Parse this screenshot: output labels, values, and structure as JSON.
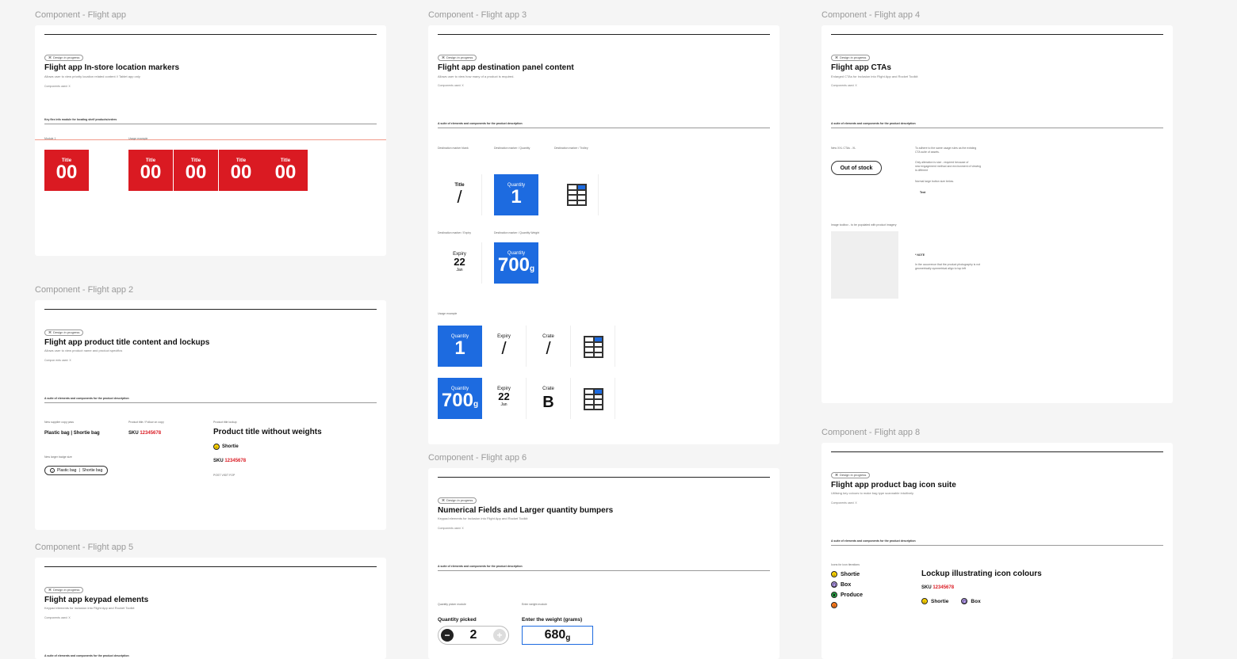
{
  "frames": {
    "f1": {
      "label": "Component - Flight app",
      "pill": "Design in progress",
      "title": "Flight app In-store location markers",
      "subtitle": "Allows user to view priority location related content // Tablet app only",
      "meta": "Components used: X",
      "section": "Key flex info module for locating shelf products/orders",
      "col1_label": "Module 1",
      "col2_label": "Usage example",
      "marker_title": "Title",
      "marker_value": "00"
    },
    "f2": {
      "label": "Component - Flight app 2",
      "pill": "Design in progress",
      "title": "Flight app product title content and lockups",
      "subtitle": "Allows user to view product name and product specifics",
      "meta": "Compon ents used: X",
      "section": "A suite of elements and components for the product description",
      "col1_label": "New supplier copy pass",
      "col2_label": "Product title / Follow on copy",
      "col3_label": "Product title lockup",
      "bag_text": "Plastic bag",
      "bag_text2": "Shortie bag",
      "sep": "|",
      "sku_label": "SKU",
      "sku_value": "12345678",
      "product_title": "Product title without weights",
      "shortie_label": "Shortie",
      "badge_label": "New larger badge size",
      "footer_note": "POST VISIT FOP"
    },
    "f3": {
      "label": "Component - Flight app 3",
      "pill": "Design in progress",
      "title": "Flight app destination panel content",
      "subtitle": "Allows user to view how many of a product is required.",
      "meta": "Components used: X",
      "section": "A suite of elements and components for the product description",
      "lab_a": "Destination marker blank",
      "lab_b": "Destination marker / Quantity",
      "lab_c": "Destination marker / Trolley",
      "lab_d": "Destination marker / Expiry",
      "lab_e": "Destination marker / Quantity Weight",
      "usage": "Usage example",
      "title_word": "Title",
      "slash": "/",
      "quantity": "Quantity",
      "qty_one": "1",
      "expiry": "Expiry",
      "day": "22",
      "month": "Jan",
      "weight": "700",
      "weight_unit": "g",
      "crate": "Crate",
      "crate_val": "B"
    },
    "f4": {
      "label": "Component - Flight app 4",
      "pill": "Design in progress",
      "title": "Flight app CTAs",
      "subtitle": "Enlarged CTAs for inclusion into Flight App and Rocket Toolkit",
      "meta": "Components used: X",
      "section": "A suite of elements and components for the product description",
      "col1_label": "New XXL CTAs - XL",
      "cta": "Out of stock",
      "note1": "To adhere to the same usage rules as the existing",
      "note1b": "CTA suite of assets.",
      "note2": "Only alteration is size - required because of",
      "note2b": "new engagement method and environment of viewing",
      "note2c": "is different",
      "note3": "Normal large button size below.",
      "small_cta": "Text",
      "img_label": "Image toolbox - to be populated with product imagery",
      "note_head": "* NOTE",
      "note_body": "In the occurrence that the product photography is not",
      "note_body2": "geometrically symmetrical align to top left"
    },
    "f5": {
      "label": "Component - Flight app 5",
      "pill": "Design in progress",
      "title": "Flight app keypad elements",
      "subtitle": "Keypad elements for inclusion into Flight App and Rocket Toolkit",
      "meta": "Components used: X",
      "section": "A suite of elements and components for the product description"
    },
    "f6": {
      "label": "Component - Flight app 6",
      "pill": "Design in progress",
      "title": "Numerical Fields and Larger quantity bumpers",
      "subtitle": "Keypad elements for inclusion into Flight App and Rocket Toolkit",
      "meta": "Components used: X",
      "section": "A suite of elements and components for the product description",
      "col1_label": "Quantity picker module",
      "col2_label": "Enter weight module",
      "qty_label": "Quantity picked",
      "qty_value": "2",
      "minus": "−",
      "plus": "+",
      "weight_label": "Enter the weight (grams)",
      "weight_value": "680",
      "weight_unit": "g"
    },
    "f8": {
      "label": "Component - Flight app 8",
      "pill": "Design in progress",
      "title": "Flight app product bag icon suite",
      "subtitle": "Utilising key colours to make bag type scannable intuitively",
      "meta": "Components used: X",
      "section": "A suite of elements and components for the product description",
      "col1_label": "Icons for icon iterations",
      "shortie": "Shortie",
      "box": "Box",
      "produce": "Produce",
      "lockup_title": "Lockup illustrating icon colours",
      "sku_label": "SKU",
      "sku_value": "12345678"
    }
  },
  "colors": {
    "red": "#da1a22",
    "blue": "#1d6be0"
  },
  "icons": {
    "pill": "design-icon",
    "bag": "bag-icon"
  }
}
